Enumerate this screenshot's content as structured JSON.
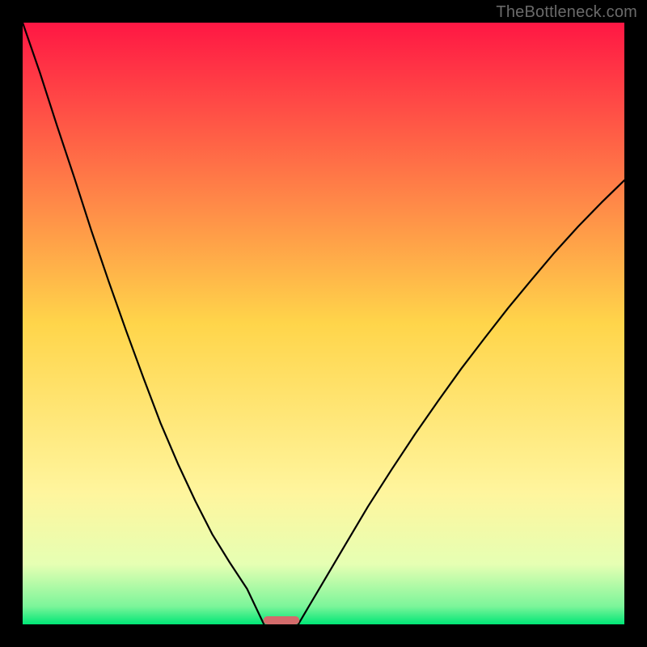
{
  "watermark": "TheBottleneck.com",
  "chart_data": {
    "type": "line",
    "title": "",
    "xlabel": "",
    "ylabel": "",
    "xlim": [
      0,
      100
    ],
    "ylim": [
      0,
      100
    ],
    "grid": false,
    "legend": false,
    "background_gradient": {
      "stops": [
        {
          "offset": 0.0,
          "color": "#ff1744"
        },
        {
          "offset": 0.5,
          "color": "#ffd54a"
        },
        {
          "offset": 0.78,
          "color": "#fff59d"
        },
        {
          "offset": 0.9,
          "color": "#e6ffb3"
        },
        {
          "offset": 0.97,
          "color": "#7cf59a"
        },
        {
          "offset": 1.0,
          "color": "#00e676"
        }
      ]
    },
    "bottom_marker": {
      "x_center": 43,
      "width": 6,
      "color": "#d36b6b"
    },
    "series": [
      {
        "name": "left-curve",
        "color": "#000000",
        "x": [
          0.0,
          2.9,
          5.7,
          8.6,
          11.4,
          14.3,
          17.2,
          20.1,
          22.9,
          25.8,
          28.7,
          31.5,
          34.4,
          37.3,
          40.1
        ],
        "y": [
          100.0,
          91.6,
          82.9,
          74.2,
          65.5,
          57.0,
          48.8,
          40.9,
          33.5,
          26.7,
          20.5,
          15.0,
          10.3,
          5.9,
          0.0
        ]
      },
      {
        "name": "right-curve",
        "color": "#000000",
        "x": [
          45.8,
          49.7,
          53.6,
          57.4,
          61.3,
          65.2,
          69.1,
          72.9,
          76.8,
          80.7,
          84.6,
          88.4,
          92.3,
          96.2,
          100.0
        ],
        "y": [
          0.0,
          6.6,
          13.2,
          19.6,
          25.7,
          31.6,
          37.2,
          42.5,
          47.6,
          52.6,
          57.3,
          61.8,
          66.1,
          70.1,
          73.8
        ]
      }
    ]
  }
}
